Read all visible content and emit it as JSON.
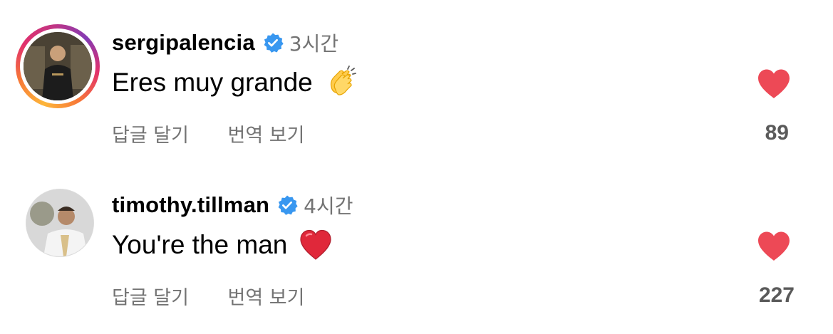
{
  "comments": [
    {
      "username": "sergipalencia",
      "verified": true,
      "time": "3시간",
      "text": "Eres muy grande",
      "emoji": "clapping-hands",
      "reply_label": "답글 달기",
      "translate_label": "번역 보기",
      "liked": true,
      "like_count": "89",
      "has_story_ring": true
    },
    {
      "username": "timothy.tillman",
      "verified": true,
      "time": "4시간",
      "text": "You're the man",
      "emoji": "red-heart",
      "reply_label": "답글 달기",
      "translate_label": "번역 보기",
      "liked": true,
      "like_count": "227",
      "has_story_ring": false
    }
  ],
  "colors": {
    "heart": "#ED4956",
    "verified": "#3897F0",
    "secondary_text": "#737373",
    "like_count": "#5A5A5A"
  }
}
